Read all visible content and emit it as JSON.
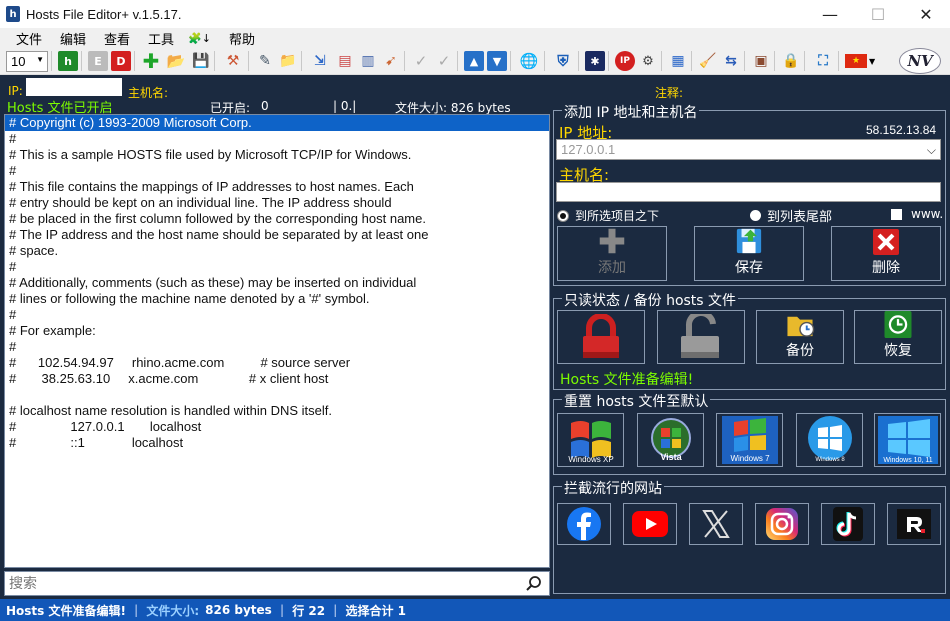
{
  "window": {
    "title": "Hosts File Editor+ v.1.5.17.",
    "app_icon": "h",
    "minimize": "—",
    "maximize": "☐",
    "close": "✕"
  },
  "menu": {
    "items": [
      "文件",
      "编辑",
      "查看",
      "工具",
      "🧩↓",
      "帮助"
    ]
  },
  "toolbar": {
    "zoom_value": "10"
  },
  "info": {
    "ip_label": "IP:",
    "hostname_label": "主机名:",
    "note_label": "注释:",
    "hosts_status": "Hosts 文件已开启",
    "enabled_label": "已开启:",
    "enabled_value": "0",
    "zero_field": "| 0.|",
    "file_size": "文件大小: 826 bytes"
  },
  "editor": {
    "lines": [
      "# Copyright (c) 1993-2009 Microsoft Corp.",
      "#",
      "# This is a sample HOSTS file used by Microsoft TCP/IP for Windows.",
      "#",
      "# This file contains the mappings of IP addresses to host names. Each",
      "# entry should be kept on an individual line. The IP address should",
      "# be placed in the first column followed by the corresponding host name.",
      "# The IP address and the host name should be separated by at least one",
      "# space.",
      "#",
      "# Additionally, comments (such as these) may be inserted on individual",
      "# lines or following the machine name denoted by a '#' symbol.",
      "#",
      "# For example:",
      "#",
      "#      102.54.94.97     rhino.acme.com          # source server",
      "#       38.25.63.10     x.acme.com              # x client host",
      "",
      "# localhost name resolution is handled within DNS itself.",
      "#               127.0.0.1       localhost",
      "#               ::1             localhost"
    ],
    "selected_line": 0
  },
  "search": {
    "placeholder": "搜索"
  },
  "statusbar": {
    "ready": "Hosts 文件准备编辑!",
    "size_label": "文件大小:",
    "size_value": "826 bytes",
    "line": "行 22",
    "selection": "选择合计 1"
  },
  "add_panel": {
    "title": "添加 IP 地址和主机名",
    "ip_label": "IP 地址:",
    "current_ip": "58.152.13.84",
    "ip_value": "127.0.0.1",
    "hostname_label": "主机名:",
    "radio_above": "到所选项目之下",
    "radio_end": "到列表尾部",
    "www_label": "www.",
    "add_label": "添加",
    "save_label": "保存",
    "delete_label": "删除"
  },
  "readonly_panel": {
    "title": "只读状态 / 备份 hosts 文件",
    "backup_label": "备份",
    "restore_label": "恢复",
    "status": "Hosts 文件准备编辑!"
  },
  "reset_panel": {
    "title": "重置 hosts 文件至默认",
    "os_labels": [
      "Windows XP",
      "Vista",
      "Windows 7",
      "Windows 8",
      "Windows 10, 11"
    ]
  },
  "block_panel": {
    "title": "拦截流行的网站",
    "sites": [
      "facebook-icon",
      "youtube-icon",
      "x-icon",
      "instagram-icon",
      "tiktok-icon",
      "roblox-icon"
    ]
  },
  "colors": {
    "background": "#1b2a40",
    "accent_yellow": "#ffd700",
    "accent_green": "#7cfc00",
    "statusbar": "#1257b8",
    "selection": "#0e63c8"
  }
}
